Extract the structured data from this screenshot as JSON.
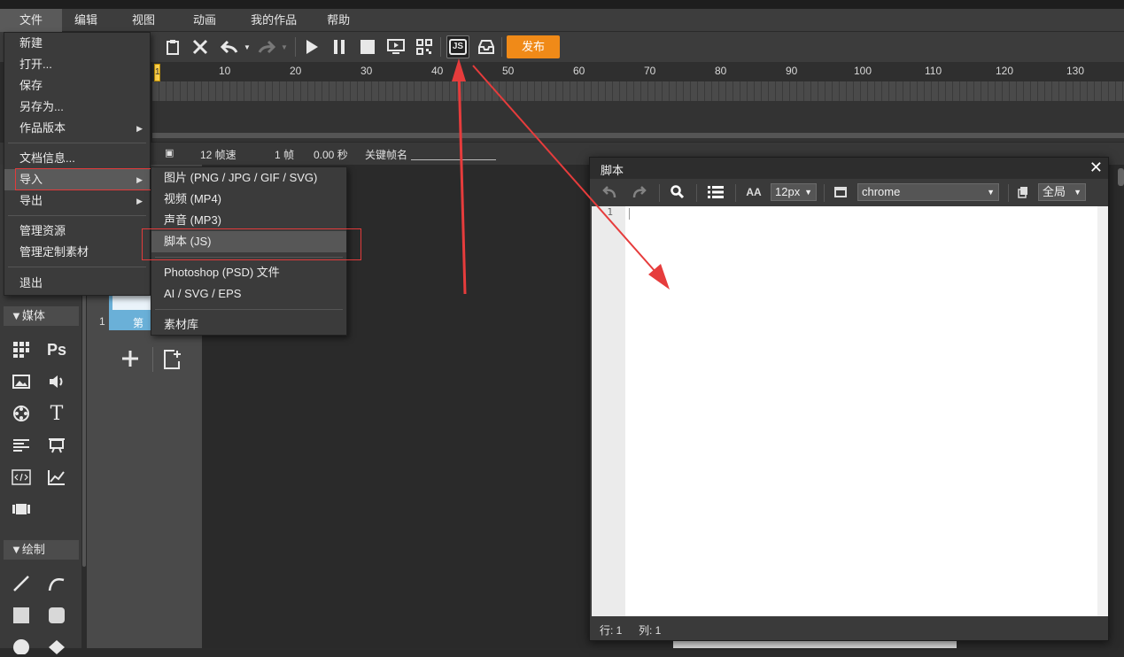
{
  "menubar": {
    "items": [
      {
        "label": "文件"
      },
      {
        "label": "编辑"
      },
      {
        "label": "视图"
      },
      {
        "label": "动画"
      },
      {
        "label": "我的作品"
      },
      {
        "label": "帮助"
      }
    ]
  },
  "toolbar": {
    "publish_label": "发布",
    "js_label": "JS"
  },
  "timeline": {
    "ticks": [
      "1",
      "10",
      "20",
      "30",
      "40",
      "50",
      "60",
      "70",
      "80",
      "90",
      "100",
      "110",
      "120",
      "130"
    ]
  },
  "status": {
    "fps": "12 帧速",
    "frame": "1 帧",
    "time": "0.00 秒",
    "keyframe_label": "关键帧名"
  },
  "file_menu": {
    "new": "新建",
    "open": "打开...",
    "save": "保存",
    "save_as": "另存为...",
    "versions": "作品版本",
    "doc_info": "文档信息...",
    "import": "导入",
    "export": "导出",
    "manage_assets": "管理资源",
    "manage_custom": "管理定制素材",
    "quit": "退出"
  },
  "import_submenu": {
    "image": "图片 (PNG / JPG / GIF / SVG)",
    "video": "视频 (MP4)",
    "audio": "声音 (MP3)",
    "script": "脚本 (JS)",
    "psd": "Photoshop (PSD) 文件",
    "ai": "AI / SVG / EPS",
    "library": "素材库"
  },
  "left_panel": {
    "media_section": "▼媒体",
    "draw_section": "▼绘制",
    "ps_label": "Ps",
    "text_tool": "T"
  },
  "scenes": {
    "number": "1",
    "label": "第"
  },
  "script_dialog": {
    "title": "脚本",
    "font_size": "12px",
    "theme": "chrome",
    "scope": "全局",
    "line_number": "1",
    "status_row": "行: 1",
    "status_col": "列: 1",
    "font_size_icon": "AA"
  },
  "colors": {
    "accent": "#f08a18",
    "highlight": "#e23b3b",
    "playhead": "#ffd24d"
  }
}
